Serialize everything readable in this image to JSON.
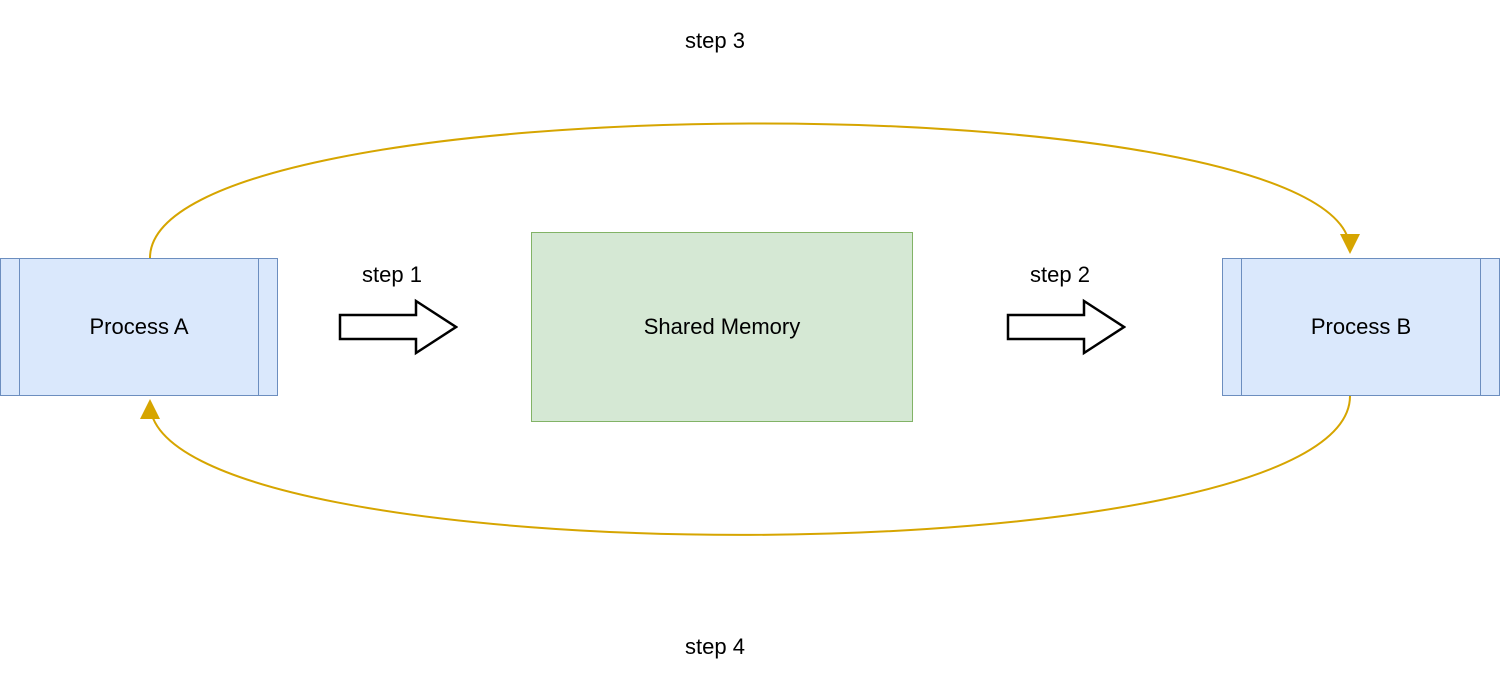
{
  "nodes": {
    "process_a": "Process A",
    "process_b": "Process B",
    "shared_memory": "Shared Memory"
  },
  "steps": {
    "step1": "step 1",
    "step2": "step 2",
    "step3": "step 3",
    "step4": "step 4"
  },
  "colors": {
    "process_fill": "#dae8fc",
    "process_stroke": "#6c8ebf",
    "memory_fill": "#d5e8d4",
    "memory_stroke": "#82b366",
    "curved_arrow": "#d6a500"
  },
  "diagram_description": {
    "type": "flow",
    "flow": [
      {
        "from": "Process A",
        "to": "Shared Memory",
        "label": "step 1",
        "style": "block-arrow"
      },
      {
        "from": "Shared Memory",
        "to": "Process B",
        "label": "step 2",
        "style": "block-arrow"
      },
      {
        "from": "Process A",
        "to": "Process B",
        "label": "step 3",
        "style": "curved-top",
        "color": "#d6a500"
      },
      {
        "from": "Process B",
        "to": "Process A",
        "label": "step 4",
        "style": "curved-bottom",
        "color": "#d6a500"
      }
    ]
  }
}
